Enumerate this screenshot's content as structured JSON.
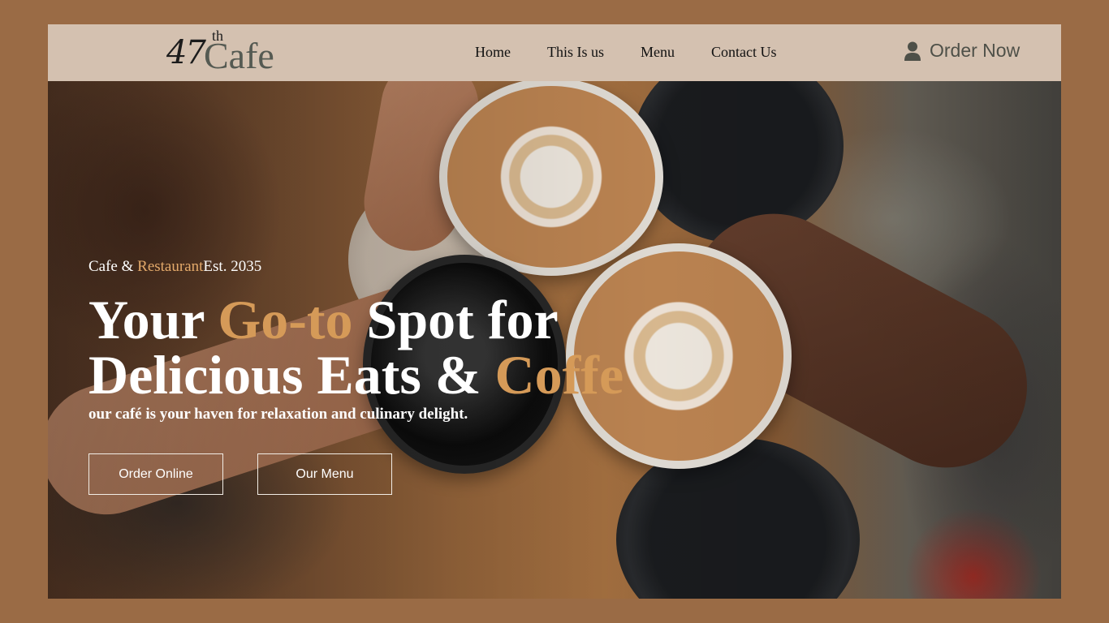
{
  "brand": {
    "logo_number": "47",
    "logo_superscript": "th",
    "logo_word": "Cafe"
  },
  "nav": {
    "items": [
      {
        "label": "Home"
      },
      {
        "label": "This Is us"
      },
      {
        "label": "Menu"
      },
      {
        "label": "Contact Us"
      }
    ]
  },
  "header_cta": {
    "label": "Order Now",
    "icon": "user-icon"
  },
  "hero": {
    "tagline_part1": "Cafe & ",
    "tagline_accent": "Restaurant",
    "tagline_part2": "Est. 2035",
    "headline_part1": "Your ",
    "headline_accent1": "Go-to",
    "headline_part2": " Spot for Delicious Eats & ",
    "headline_accent2": "Coffe",
    "subtitle": "our café is your haven for relaxation and culinary delight.",
    "buttons": {
      "order_online": "Order Online",
      "our_menu": "Our Menu"
    }
  },
  "colors": {
    "page_background": "#9a6b45",
    "header_background": "#d4c1b0",
    "accent": "#d59a58",
    "logo_text": "#555a52"
  }
}
